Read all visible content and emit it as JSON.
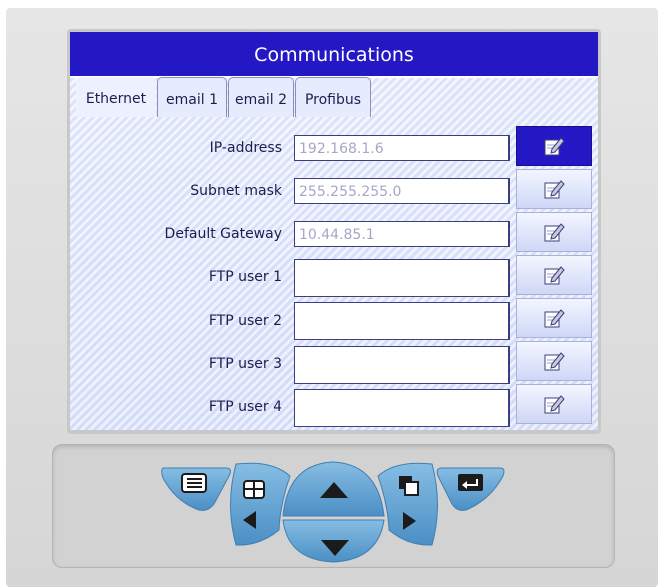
{
  "header": {
    "title": "Communications"
  },
  "tabs": [
    {
      "label": "Ethernet",
      "active": true
    },
    {
      "label": "email 1",
      "active": false
    },
    {
      "label": "email 2",
      "active": false
    },
    {
      "label": "Profibus",
      "active": false
    }
  ],
  "rows": [
    {
      "label": "IP-address",
      "value": "192.168.1.6"
    },
    {
      "label": "Subnet mask",
      "value": "255.255.255.0"
    },
    {
      "label": "Default Gateway",
      "value": "10.44.85.1"
    },
    {
      "label": "FTP user 1",
      "value": ""
    },
    {
      "label": "FTP user 2",
      "value": ""
    },
    {
      "label": "FTP user 3",
      "value": ""
    },
    {
      "label": "FTP user 4",
      "value": ""
    }
  ],
  "icons": {
    "edit": "edit-pencil-icon",
    "menu": "menu-list-icon",
    "grid": "grid-view-icon",
    "up": "arrow-up-icon",
    "down": "arrow-down-icon",
    "left": "arrow-left-icon",
    "right": "arrow-right-icon",
    "copy": "copy-windows-icon",
    "enter": "enter-icon"
  },
  "colors": {
    "title_bar": "#2417c4",
    "screen_bg": "#e4e9fc",
    "key_blue": "#5c9fd2"
  }
}
